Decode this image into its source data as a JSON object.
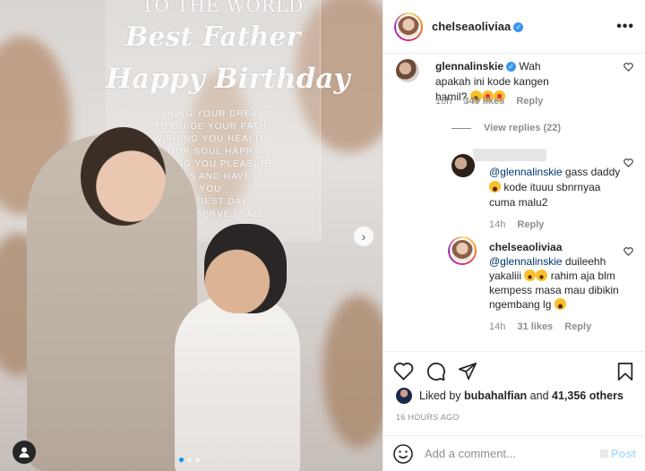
{
  "sign": {
    "line1": "TO THE WORLD",
    "line2": "Best Father",
    "line3": "Happy Birthday",
    "small": [
      "WISHING YOUR DREAMS",
      "TO GUIDE YOUR PATH",
      "WISHING YOU HEALTH",
      "YOUR SOUL HAPPY",
      "WISHING YOU PLEASURE",
      "THINGS AND HAVE IT",
      "YOU",
      "HAPPIEST DAY",
      "YOU DESERVE IT ALL"
    ]
  },
  "header": {
    "username": "chelseaoliviaa",
    "verified_mark": "✓",
    "more": "•••"
  },
  "comments": [
    {
      "username": "glennalinskie",
      "verified": true,
      "text": "Wah apakah ini kode kangen hamil?",
      "time": "16h",
      "likes": "349 likes",
      "reply": "Reply"
    }
  ],
  "view_replies": "View replies (22)",
  "replies": [
    {
      "username": "",
      "mention": "@glennalinskie",
      "text": "gass daddy",
      "text2": "kode ituuu sbnrnyaa cuma malu2",
      "time": "14h",
      "reply": "Reply"
    },
    {
      "username": "chelseaoliviaa",
      "mention": "@glennalinskie",
      "text": "duileehh yakaliii",
      "text2": "rahim aja blm kempess masa mau dibikin ngembang lg",
      "time": "14h",
      "likes": "31 likes",
      "reply": "Reply"
    }
  ],
  "likes": {
    "prefix": "Liked by ",
    "user": "bubahalfian",
    "mid": " and ",
    "count": "41,356 others"
  },
  "timestamp": "16 HOURS AGO",
  "add_comment": {
    "placeholder": "Add a comment...",
    "post_label": "Post"
  },
  "carousel": {
    "slides": 3,
    "active": 1,
    "next_glyph": "›"
  },
  "colors": {
    "link_blue": "#00376b",
    "verified_blue": "#3897f0",
    "meta_gray": "#8e8e8e",
    "post_disabled": "#b2dffc"
  }
}
